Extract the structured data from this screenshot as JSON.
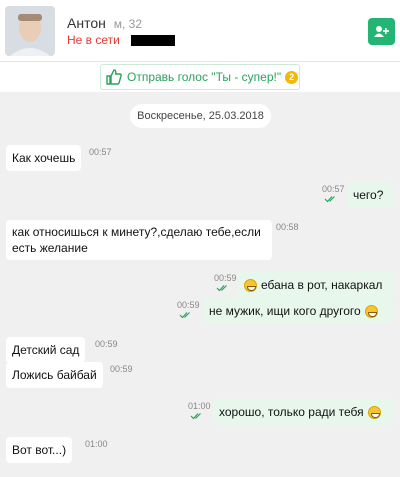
{
  "contact": {
    "name": "Антон",
    "gender_age": "м, 32",
    "status": "Не в сети"
  },
  "vote": {
    "label": "Отправь голос \"Ты - супер!\"",
    "count": "2"
  },
  "date": "Воскресенье, 25.03.2018",
  "messages": [
    {
      "text": "Как хочешь",
      "time": "00:57",
      "dir": "in"
    },
    {
      "text": "чего?",
      "time": "00:57",
      "dir": "out"
    },
    {
      "text": "как относишься к минету?,сделаю тебе,если есть желание",
      "time": "00:58",
      "dir": "in"
    },
    {
      "text": "ебана в рот, накаркал",
      "time": "00:59",
      "dir": "out"
    },
    {
      "text": "не мужик, ищи кого другого",
      "time": "00:59",
      "dir": "out"
    },
    {
      "text": "Детский сад",
      "time": "00:59",
      "dir": "in"
    },
    {
      "text": "Ложись байбай",
      "time": "00:59",
      "dir": "in"
    },
    {
      "text": "хорошо, только ради тебя",
      "time": "01:00",
      "dir": "out"
    },
    {
      "text": "Вот вот...)",
      "time": "01:00",
      "dir": "in"
    }
  ],
  "colors": {
    "accent": "#22b573",
    "offline": "#e53935",
    "chat_bg": "#f0f0f0",
    "out_bubble": "#e8f7ec"
  }
}
